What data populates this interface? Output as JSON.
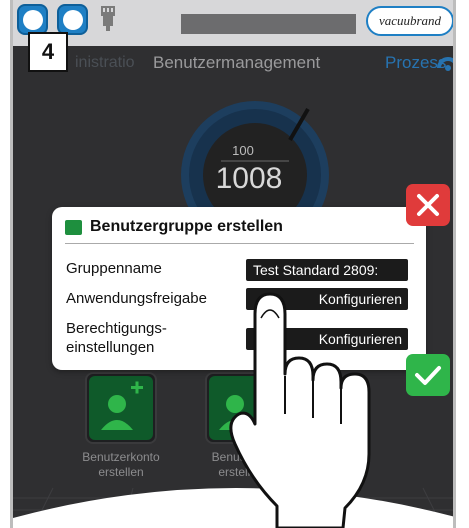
{
  "topbar": {
    "brand_logo": "vacuubrand",
    "icons": [
      "status-button-icon",
      "status-button-icon",
      "network-icon"
    ]
  },
  "step": {
    "number": "4"
  },
  "tabs": {
    "left": "inistratio",
    "center": "Benutzermanagement",
    "right": "Prozess"
  },
  "gauge": {
    "small_value": "100",
    "big_value": "1008"
  },
  "tiles": [
    {
      "label_line1": "Benutzerkonto",
      "label_line2": "erstellen"
    },
    {
      "label_line1": "Benutzergr",
      "label_line2": "erstellen"
    }
  ],
  "dialog": {
    "title": "Benutzergruppe erstellen",
    "rows": [
      {
        "label": "Gruppenname",
        "value": "Test Standard 2809:"
      },
      {
        "label": "Anwendungsfreigabe",
        "value": "Konfigurieren"
      },
      {
        "label_line1": "Berechtigungs-",
        "label_line2": "einstellungen",
        "value": "Konfigurieren"
      }
    ]
  },
  "colors": {
    "accent_blue": "#1e7fc4",
    "cancel_red": "#e03b3b",
    "confirm_green": "#2fb54a"
  }
}
